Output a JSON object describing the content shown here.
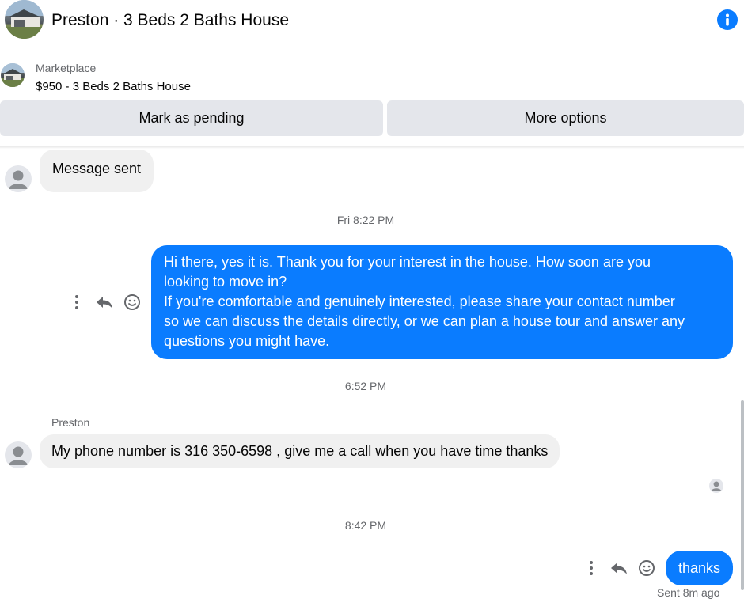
{
  "header": {
    "title": "Preston · 3 Beds 2 Baths House"
  },
  "marketplace": {
    "label": "Marketplace",
    "listing": "$950 - 3 Beds 2 Baths House"
  },
  "actions": {
    "pending": "Mark as pending",
    "options": "More options"
  },
  "messages": {
    "system_sent": "Message sent",
    "time1": "Fri 8:22 PM",
    "outgoing1_lines": [
      "Hi there, yes it is. Thank you for your interest in the house. How soon are you",
      "looking to move in?",
      "If you're comfortable and genuinely interested, please share your contact number",
      "so we can discuss the details directly, or we can plan a house tour and answer any",
      "questions you might have."
    ],
    "time2": "6:52 PM",
    "sender_name": "Preston",
    "incoming1": "My  phone number is 316 350-6598 ,  give me a call when you have time thanks",
    "time3": "8:42 PM",
    "outgoing2": "thanks",
    "status": "Sent 8m ago"
  },
  "colors": {
    "accent": "#0a7cff",
    "bubble_in": "#f0f0f0",
    "button_bg": "#e4e6eb",
    "muted_text": "#65676b"
  },
  "icons": [
    "info-icon",
    "more-vertical-icon",
    "reply-icon",
    "emoji-icon",
    "default-avatar-icon"
  ]
}
